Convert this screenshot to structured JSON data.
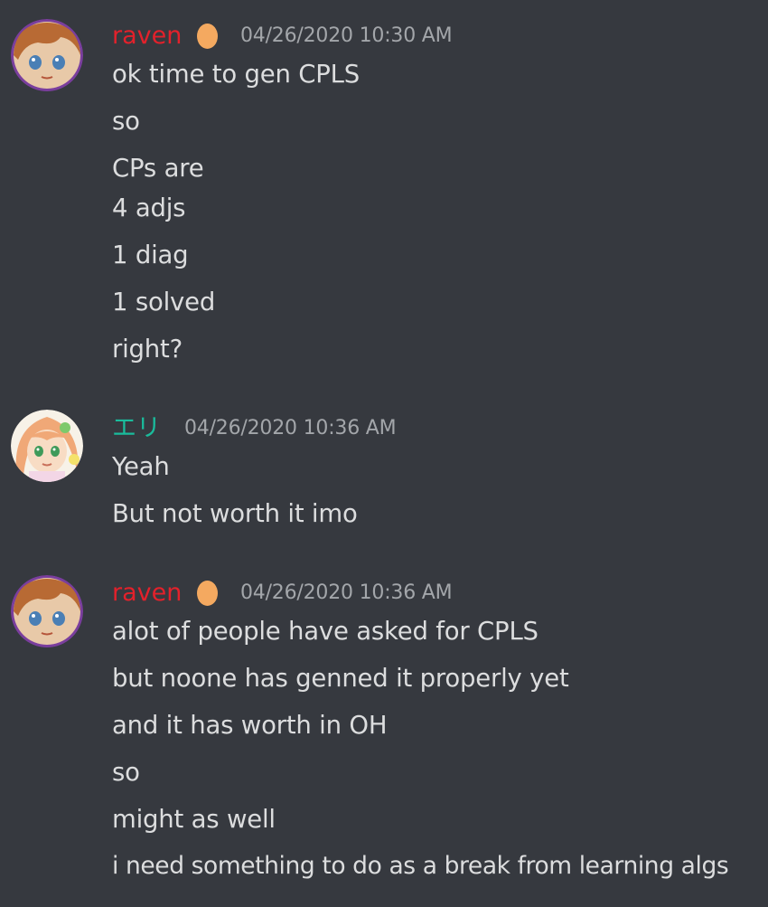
{
  "colors": {
    "background": "#36393f",
    "raven_name": "#e3212b",
    "eri_name": "#1abc9c",
    "badge": "#f4a960",
    "text": "#dcddde",
    "timestamp": "#a3a6aa"
  },
  "messages": [
    {
      "username": "raven",
      "timestamp": "04/26/2020 10:30 AM",
      "badge_icon": "egg-badge-icon",
      "lines": [
        "ok time to gen CPLS",
        "so",
        "CPs are",
        "4 adjs",
        "1 diag",
        "1 solved",
        "right?"
      ]
    },
    {
      "username": "エリ",
      "timestamp": "04/26/2020 10:36 AM",
      "lines": [
        "Yeah",
        "But not worth it imo"
      ]
    },
    {
      "username": "raven",
      "timestamp": "04/26/2020 10:36 AM",
      "badge_icon": "egg-badge-icon",
      "lines": [
        "alot of people have asked for CPLS",
        "but noone has genned it properly yet",
        "and it has worth in OH",
        "so",
        "might as well",
        "i need something to do as a break from learning algs"
      ]
    }
  ]
}
